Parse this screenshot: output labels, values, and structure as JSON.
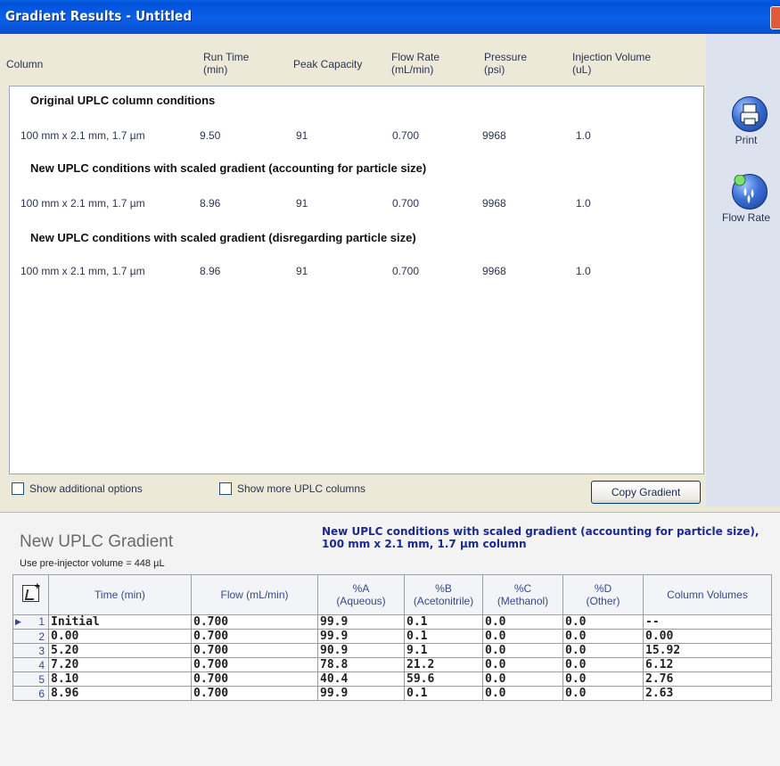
{
  "window": {
    "title": "Gradient Results - Untitled"
  },
  "columns": {
    "column": "Column",
    "run_time": [
      "Run Time",
      "(min)"
    ],
    "peak_capacity": "Peak Capacity",
    "flow_rate": [
      "Flow Rate",
      "(mL/min)"
    ],
    "pressure": [
      "Pressure",
      "(psi)"
    ],
    "injection_volume": [
      "Injection Volume",
      "(uL)"
    ]
  },
  "sections": [
    {
      "title": "Original UPLC column conditions",
      "row": {
        "column": "100 mm x 2.1 mm, 1.7 µm",
        "run_time": "9.50",
        "peak_capacity": "91",
        "flow_rate": "0.700",
        "pressure": "9968",
        "injection_volume": "1.0"
      }
    },
    {
      "title": "New UPLC conditions with scaled gradient (accounting for particle size)",
      "row": {
        "column": "100 mm x 2.1 mm, 1.7 µm",
        "run_time": "8.96",
        "peak_capacity": "91",
        "flow_rate": "0.700",
        "pressure": "9968",
        "injection_volume": "1.0"
      }
    },
    {
      "title": "New UPLC conditions with scaled gradient (disregarding particle size)",
      "row": {
        "column": "100 mm x 2.1 mm, 1.7 µm",
        "run_time": "8.96",
        "peak_capacity": "91",
        "flow_rate": "0.700",
        "pressure": "9968",
        "injection_volume": "1.0"
      }
    }
  ],
  "sidebar": {
    "print_label": "Print",
    "flow_rate_label": "Flow Rate"
  },
  "options": {
    "show_additional": "Show additional options",
    "show_more_columns": "Show more UPLC columns",
    "copy_gradient": "Copy Gradient"
  },
  "gradient": {
    "title": "New UPLC Gradient",
    "subtitle": "Use pre-injector volume = 448 µL",
    "desc_line1": "New UPLC conditions with scaled gradient (accounting for particle size),",
    "desc_line2": "100 mm x 2.1 mm, 1.7 µm column",
    "headers": {
      "time": "Time (min)",
      "flow": "Flow (mL/min)",
      "a": [
        "%A",
        "(Aqueous)"
      ],
      "b": [
        "%B",
        "(Acetonitrile)"
      ],
      "c": [
        "%C",
        "(Methanol)"
      ],
      "d": [
        "%D",
        "(Other)"
      ],
      "cv": "Column Volumes"
    },
    "rows": [
      {
        "n": "1",
        "time": "Initial",
        "flow": "0.700",
        "a": "99.9",
        "b": "0.1",
        "c": "0.0",
        "d": "0.0",
        "cv": "--"
      },
      {
        "n": "2",
        "time": "0.00",
        "flow": "0.700",
        "a": "99.9",
        "b": "0.1",
        "c": "0.0",
        "d": "0.0",
        "cv": "0.00"
      },
      {
        "n": "3",
        "time": "5.20",
        "flow": "0.700",
        "a": "90.9",
        "b": "9.1",
        "c": "0.0",
        "d": "0.0",
        "cv": "15.92"
      },
      {
        "n": "4",
        "time": "7.20",
        "flow": "0.700",
        "a": "78.8",
        "b": "21.2",
        "c": "0.0",
        "d": "0.0",
        "cv": "6.12"
      },
      {
        "n": "5",
        "time": "8.10",
        "flow": "0.700",
        "a": "40.4",
        "b": "59.6",
        "c": "0.0",
        "d": "0.0",
        "cv": "2.76"
      },
      {
        "n": "6",
        "time": "8.96",
        "flow": "0.700",
        "a": "99.9",
        "b": "0.1",
        "c": "0.0",
        "d": "0.0",
        "cv": "2.63"
      }
    ]
  },
  "colors": {
    "titlebar": "#0A5FE0",
    "accent_text": "#1B2A90",
    "close": "#E0593B"
  }
}
